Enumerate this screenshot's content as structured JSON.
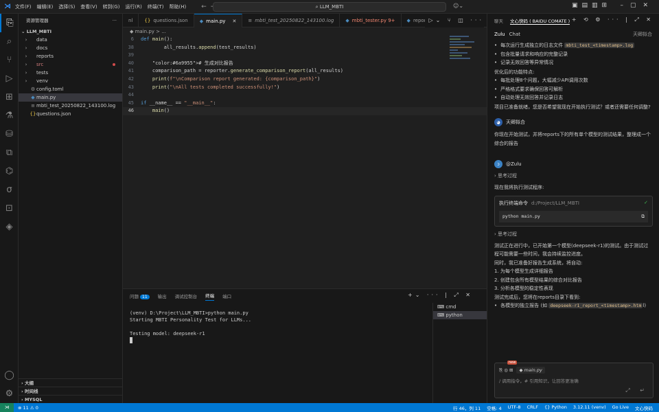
{
  "titlebar": {
    "menu": [
      "文件(F)",
      "编辑(E)",
      "选择(S)",
      "查看(V)",
      "转到(G)",
      "运行(R)",
      "终端(T)",
      "帮助(H)"
    ],
    "search": "LLM_MBTI"
  },
  "sidebar": {
    "title": "资源管理器",
    "more": "···",
    "root": "LLM_MBTI",
    "items": [
      {
        "label": "data",
        "type": "folder"
      },
      {
        "label": "docs",
        "type": "folder"
      },
      {
        "label": "reports",
        "type": "folder"
      },
      {
        "label": "src",
        "type": "folder",
        "modified": true
      },
      {
        "label": "tests",
        "type": "folder"
      },
      {
        "label": "venv",
        "type": "folder"
      },
      {
        "label": "config.toml",
        "type": "file"
      },
      {
        "label": "main.py",
        "type": "file"
      },
      {
        "label": "mbti_test_20250822_143100.log",
        "type": "file"
      },
      {
        "label": "questions.json",
        "type": "file"
      }
    ],
    "bottom": [
      "大纲",
      "时间线",
      "MYSQL"
    ]
  },
  "tabs": [
    {
      "label": "nl",
      "icon": ""
    },
    {
      "label": "questions.json",
      "icon": "{}"
    },
    {
      "label": "main.py",
      "icon": "◆",
      "active": true
    },
    {
      "label": "mbti_test_20250822_143100.log",
      "icon": "≡",
      "italic": true
    },
    {
      "label": "mbti_tester.py 9+",
      "icon": "◆",
      "err": true
    },
    {
      "label": "report_generator.p",
      "icon": "◆"
    }
  ],
  "breadcrumb": "◆ main.py > ...",
  "code": [
    {
      "n": "6",
      "t": "def main():"
    },
    {
      "n": "38",
      "t": "        all_results.append(test_results)"
    },
    {
      "n": "39",
      "t": ""
    },
    {
      "n": "40",
      "t": "    # 生成对比报告"
    },
    {
      "n": "41",
      "t": "    comparison_path = reporter.generate_comparison_report(all_results)"
    },
    {
      "n": "42",
      "t": "    print(f\"\\nComparison report generated: {comparison_path}\")"
    },
    {
      "n": "43",
      "t": "    print(\"\\nAll tests completed successfully!\")"
    },
    {
      "n": "44",
      "t": ""
    },
    {
      "n": "45",
      "t": "if __name__ == \"__main__\":"
    },
    {
      "n": "46",
      "t": "    main()"
    }
  ],
  "panel": {
    "tabs": [
      "问题",
      "输出",
      "调试控制台",
      "终端",
      "端口"
    ],
    "problems_count": "11",
    "terminal": "(venv) D:\\Project\\LLM_MBTI>python main.py\nStarting MBTI Personality Test for LLMs...\n\nTesting model: deepseek-r1",
    "terminals": [
      "cmd",
      "python"
    ]
  },
  "chat": {
    "tabs": [
      "聊天",
      "文心快码 ( BAIDU COMATE )"
    ],
    "sub": {
      "name": "Zulu",
      "mode": "Chat",
      "agent": "天卿拟合"
    },
    "lines_top": [
      {
        "t": "每次运行生成独立的日志文件 ",
        "code": "mbti_test_<timestamp>.log",
        "bul": true
      },
      {
        "t": "包含批量请求和响应的完整记录",
        "bul": true
      },
      {
        "t": "记录无效回答等异常情况",
        "bul": true
      },
      {
        "t": "优化后的功能特点:",
        "bul": false
      },
      {
        "t": "每批处理8个问题，大幅减少API调用次数",
        "bul": true
      },
      {
        "t": "严格格式要求确保回答可解析",
        "bul": true
      },
      {
        "t": "自动处理无效回答并记录日志",
        "bul": true
      },
      {
        "t": "项目已准备就绪，您是否希望我现在开始执行测试？或者还需要任何调整?",
        "bul": false
      }
    ],
    "user_name": "天卿拟合",
    "user_msg": "你现在开始测试，并将reports下的所有单个模型的测试结果，整理成一个综合的报告",
    "bot_name": "@Zulu",
    "think1": "思考过程",
    "exec_intro": "现在我将执行测试程序:",
    "run": {
      "title": "执行终端命令",
      "path": "d:/Project/LLM_MBTI",
      "cmd": "python main.py"
    },
    "think2": "思考过程",
    "lines_bottom": [
      {
        "t": "测试正在进行中，已开始第一个模型(deepseek-r1)的测试。由于测试过程可能需要一些时间，我会持续监控进度。"
      },
      {
        "t": "同时，我已准备好报告生成系统，将自动:"
      },
      {
        "t": "1. 为每个模型生成详细报告"
      },
      {
        "t": "2. 创建包含所有模型结果的综合对比报告"
      },
      {
        "t": "3. 分析各模型的稳定性表现"
      },
      {
        "t": "测试完成后，您将在reports目录下看到:"
      }
    ],
    "last_bullet": {
      "t": "各模型的独立报告 (如 ",
      "code": "deepseek-r1_report_<timestamp>.htm",
      "tail": "l)"
    },
    "input": {
      "new": "new",
      "file": "main.py",
      "placeholder": "/ 调用指令，# 引用知识，让回答更准确"
    }
  },
  "status": {
    "left": "⊗ 11 ⚠ 0",
    "right": [
      "行 46，列 11",
      "空格: 4",
      "UTF-8",
      "CRLF",
      "{} Python",
      "3.12.11 (venv)",
      "Go Live",
      "文心快码"
    ]
  }
}
